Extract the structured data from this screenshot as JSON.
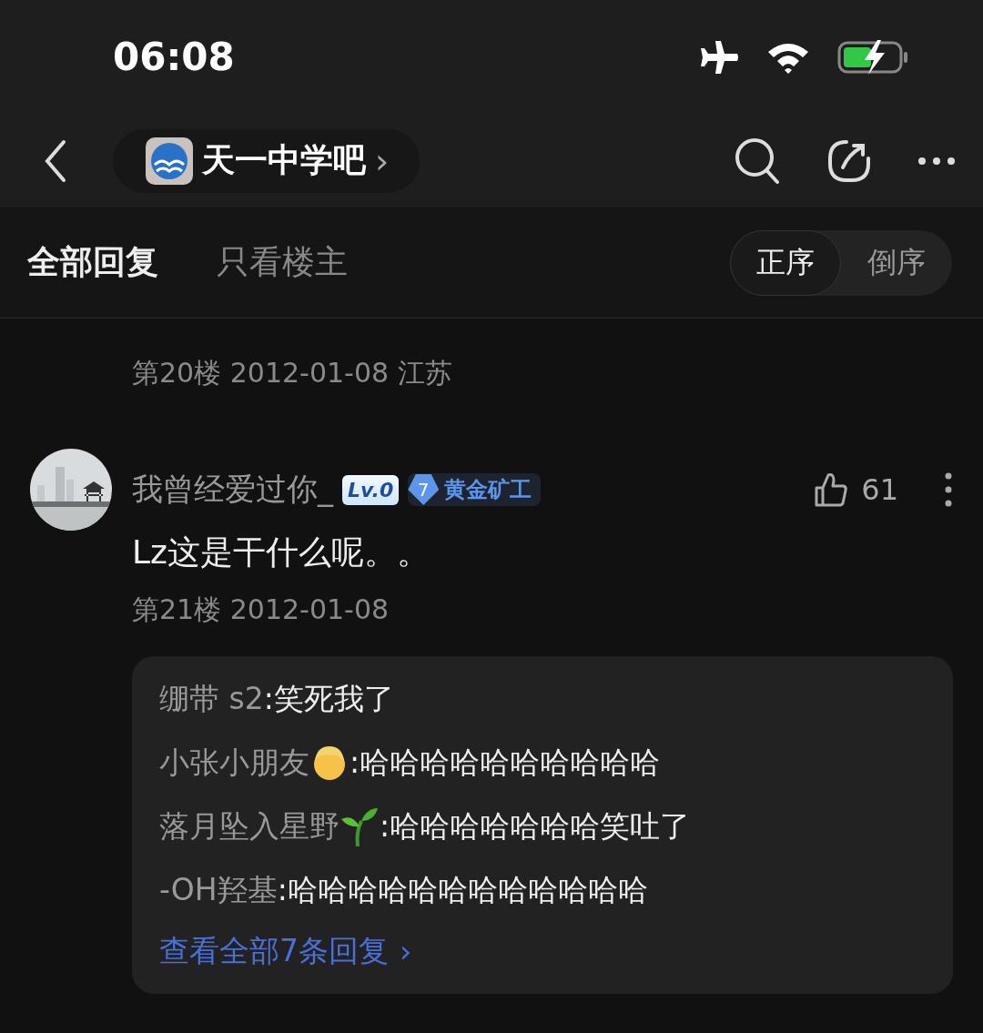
{
  "status_bar": {
    "time": "06:08"
  },
  "nav": {
    "forum_name": "天一中学吧",
    "chevron": "›"
  },
  "tabs": [
    {
      "label": "全部回复",
      "selected": true
    },
    {
      "label": "只看楼主",
      "selected": false
    }
  ],
  "sort": [
    {
      "label": "正序",
      "selected": true
    },
    {
      "label": "倒序",
      "selected": false
    }
  ],
  "previous_floor": {
    "meta": "第20楼 2012-01-08 江苏"
  },
  "post": {
    "author": "我曾经爱过你_",
    "level_badge": "Lv.0",
    "rank_number": "7",
    "rank_title": "黄金矿工",
    "likes": "61",
    "content": "Lz这是干什么呢。。",
    "meta": "第21楼 2012-01-08",
    "replies": [
      {
        "kind": "plain",
        "author": "绷带 s2",
        "text": ":笑死我了"
      },
      {
        "kind": "boy",
        "author": "小张小朋友",
        "text": ":哈哈哈哈哈哈哈哈哈哈"
      },
      {
        "kind": "sprout",
        "author": "落月坠入星野",
        "text": ":哈哈哈哈哈哈哈笑吐了"
      },
      {
        "kind": "plain",
        "author": "-OH羟基",
        "text": ":哈哈哈哈哈哈哈哈哈哈哈哈"
      }
    ],
    "more_link": "查看全部7条回复",
    "more_chevron": "›"
  }
}
